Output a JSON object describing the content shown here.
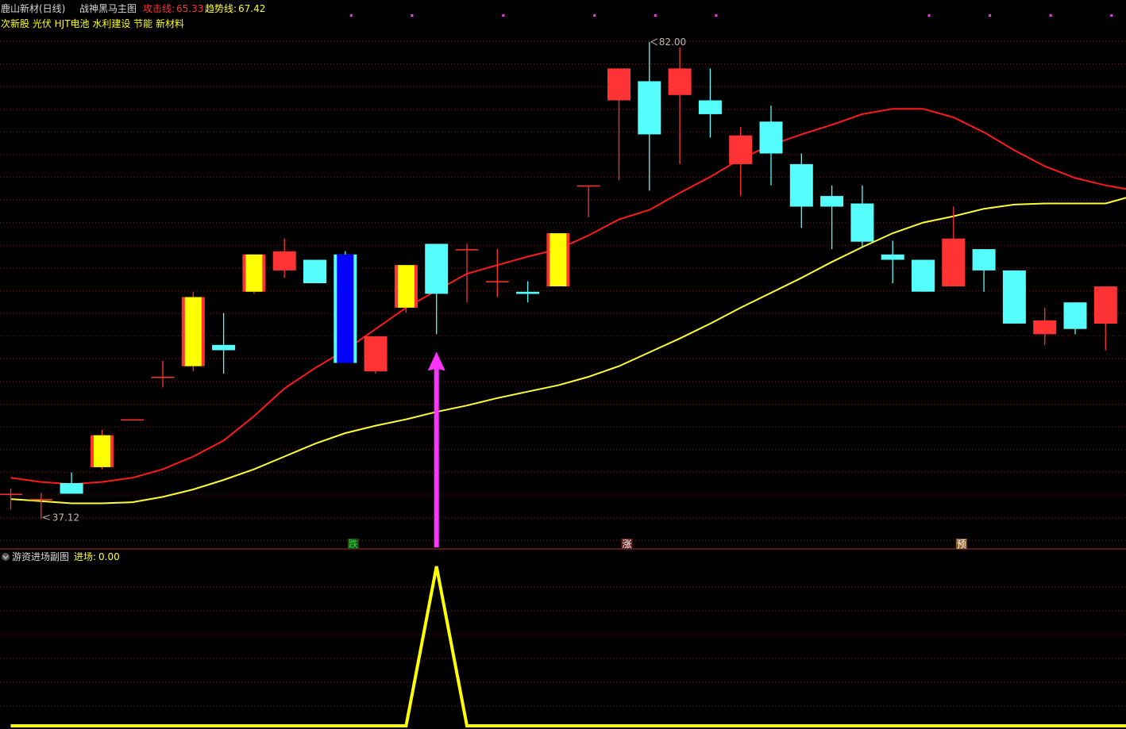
{
  "main_header": {
    "name": "鹿山新材(日线)",
    "indicator": "战神黑马主图",
    "attack_label": "攻击线:",
    "attack_value": "65.33",
    "trend_label": "趋势线:",
    "trend_value": "67.42",
    "concepts": "次新股 光伏 HJT电池 水利建设 节能 新材料"
  },
  "sub_header": {
    "name": "游资进场副图",
    "entry_label": "进场:",
    "entry_value": "0.00"
  },
  "annotations": {
    "high_label": "82.00",
    "low_label": "37.12",
    "markers": [
      {
        "text": "跌",
        "index": 11,
        "color": "#2fd42f",
        "bg": "#1a4d1a"
      },
      {
        "text": "涨",
        "index": 20,
        "color": "#ffffff",
        "bg": "#6b1f1f"
      },
      {
        "text": "预",
        "index": 31,
        "color": "#ffffff",
        "bg": "#8a5a2a"
      }
    ]
  },
  "colors": {
    "up": "#ff3333",
    "down": "#54fcfc",
    "highlight_up": "#ffff00",
    "highlight_down": "#0000ff",
    "attack_line": "#ff1a1a",
    "trend_line": "#ffff33",
    "arrow": "#ff33ff",
    "entry_line": "#ffff00",
    "grid": "#6e1e1e"
  },
  "chart_data": [
    {
      "type": "candlestick",
      "ylim": [
        35.5,
        84.0
      ],
      "candles": [
        {
          "o": 39.5,
          "h": 40.0,
          "l": 38.0,
          "c": 39.5
        },
        {
          "o": 39.0,
          "h": 39.6,
          "l": 37.12,
          "c": 39.0
        },
        {
          "o": 40.5,
          "h": 41.5,
          "l": 40.5,
          "c": 39.5,
          "hl": false
        },
        {
          "o": 42.0,
          "h": 45.5,
          "l": 41.8,
          "c": 45.0,
          "hl": "up"
        },
        {
          "o": 46.5,
          "h": 46.5,
          "l": 46.5,
          "c": 46.5
        },
        {
          "o": 50.5,
          "h": 52.0,
          "l": 49.5,
          "c": 50.5
        },
        {
          "o": 51.5,
          "h": 58.5,
          "l": 51.0,
          "c": 58.0,
          "hl": "up"
        },
        {
          "o": 53.5,
          "h": 56.5,
          "l": 50.8,
          "c": 53.0
        },
        {
          "o": 58.5,
          "h": 62.0,
          "l": 58.3,
          "c": 62.0,
          "hl": "up"
        },
        {
          "o": 60.5,
          "h": 63.5,
          "l": 59.8,
          "c": 62.3
        },
        {
          "o": 61.5,
          "h": 61.5,
          "l": 59.3,
          "c": 59.3
        },
        {
          "o": 62.0,
          "h": 62.3,
          "l": 51.8,
          "c": 51.8,
          "hl": "down"
        },
        {
          "o": 51.0,
          "h": 54.3,
          "l": 50.8,
          "c": 54.3
        },
        {
          "o": 57.0,
          "h": 61.0,
          "l": 56.5,
          "c": 61.0,
          "hl": "up"
        },
        {
          "o": 63.0,
          "h": 63.0,
          "l": 54.5,
          "c": 58.3
        },
        {
          "o": 62.5,
          "h": 63.0,
          "l": 57.5,
          "c": 62.5
        },
        {
          "o": 59.5,
          "h": 62.5,
          "l": 58.0,
          "c": 59.5
        },
        {
          "o": 58.5,
          "h": 59.5,
          "l": 57.5,
          "c": 58.3
        },
        {
          "o": 59.0,
          "h": 64.0,
          "l": 59.0,
          "c": 64.0,
          "hl": "up"
        },
        {
          "o": 68.5,
          "h": 68.5,
          "l": 65.5,
          "c": 68.5
        },
        {
          "o": 76.5,
          "h": 76.5,
          "l": 69.0,
          "c": 79.5
        },
        {
          "o": 78.3,
          "h": 82.0,
          "l": 68.0,
          "c": 73.3
        },
        {
          "o": 77.0,
          "h": 81.5,
          "l": 70.5,
          "c": 79.5
        },
        {
          "o": 76.5,
          "h": 79.5,
          "l": 73.0,
          "c": 75.2
        },
        {
          "o": 70.5,
          "h": 74.0,
          "l": 67.5,
          "c": 73.2
        },
        {
          "o": 74.5,
          "h": 76.0,
          "l": 68.5,
          "c": 71.5
        },
        {
          "o": 70.5,
          "h": 71.5,
          "l": 64.5,
          "c": 66.5
        },
        {
          "o": 67.5,
          "h": 68.5,
          "l": 62.5,
          "c": 66.5
        },
        {
          "o": 66.8,
          "h": 68.5,
          "l": 62.7,
          "c": 63.2
        },
        {
          "o": 62.0,
          "h": 63.3,
          "l": 59.3,
          "c": 61.5
        },
        {
          "o": 61.5,
          "h": 61.5,
          "l": 58.5,
          "c": 58.5
        },
        {
          "o": 59.0,
          "h": 66.5,
          "l": 59.0,
          "c": 63.5
        },
        {
          "o": 62.5,
          "h": 62.5,
          "l": 58.5,
          "c": 60.5
        },
        {
          "o": 60.5,
          "h": 60.5,
          "l": 55.5,
          "c": 55.5
        },
        {
          "o": 54.5,
          "h": 57.0,
          "l": 53.5,
          "c": 55.8
        },
        {
          "o": 57.5,
          "h": 57.5,
          "l": 54.5,
          "c": 55.0
        },
        {
          "o": 55.5,
          "h": 59.0,
          "l": 53.0,
          "c": 59.0
        }
      ],
      "attack_line": [
        41.0,
        40.6,
        40.4,
        40.6,
        41.0,
        41.8,
        43.0,
        44.5,
        46.8,
        49.4,
        51.3,
        53.0,
        55.0,
        57.0,
        58.6,
        60.2,
        61.0,
        61.8,
        62.5,
        63.8,
        65.3,
        66.2,
        67.8,
        69.3,
        71.0,
        72.3,
        73.3,
        74.2,
        75.2,
        75.7,
        75.7,
        74.9,
        73.5,
        71.8,
        70.3,
        69.2,
        68.5,
        68.0
      ],
      "trend_line": [
        39.0,
        38.8,
        38.6,
        38.6,
        38.7,
        39.2,
        39.9,
        40.8,
        41.8,
        43.0,
        44.2,
        45.2,
        45.9,
        46.5,
        47.2,
        47.8,
        48.5,
        49.1,
        49.7,
        50.5,
        51.5,
        52.8,
        54.1,
        55.5,
        57.0,
        58.4,
        59.8,
        61.3,
        62.7,
        64.0,
        65.0,
        65.6,
        66.3,
        66.7,
        66.8,
        66.8,
        66.8,
        67.6
      ],
      "arrow_index": 14
    },
    {
      "type": "line",
      "ylim": [
        0,
        1
      ],
      "values": [
        0,
        0,
        0,
        0,
        0,
        0,
        0,
        0,
        0,
        0,
        0,
        0,
        0,
        0,
        1,
        0,
        0,
        0,
        0,
        0,
        0,
        0,
        0,
        0,
        0,
        0,
        0,
        0,
        0,
        0,
        0,
        0,
        0,
        0,
        0,
        0,
        0,
        0
      ]
    }
  ]
}
